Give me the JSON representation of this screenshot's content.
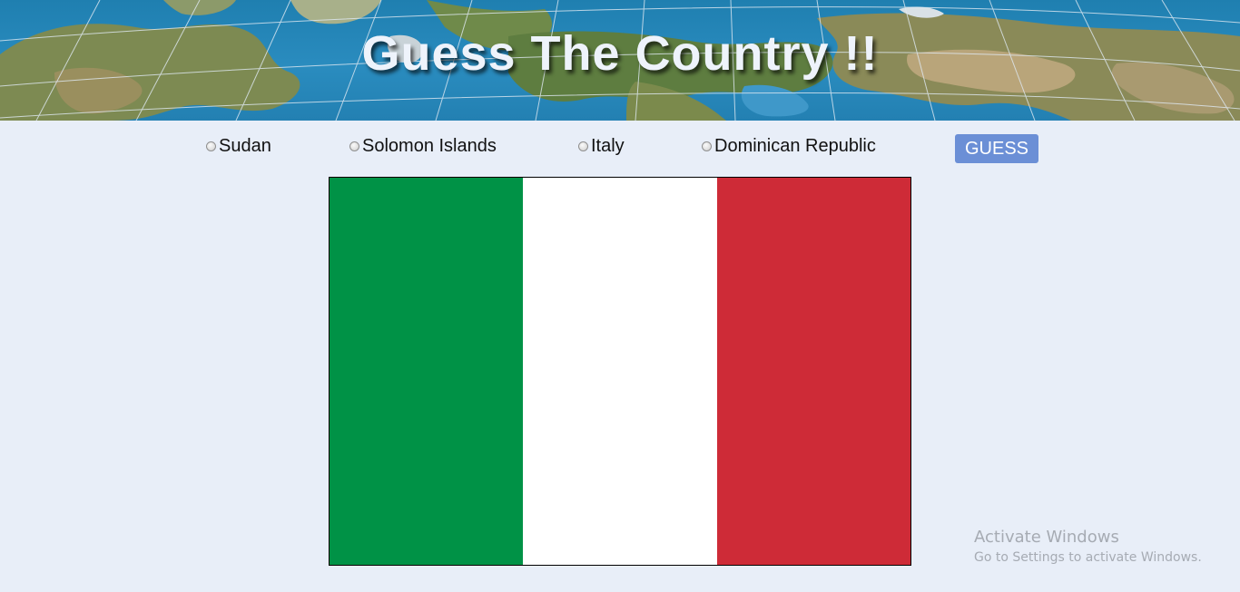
{
  "header": {
    "title": "Guess The Country !!"
  },
  "quiz": {
    "options": [
      {
        "label": "Sudan"
      },
      {
        "label": "Solomon Islands"
      },
      {
        "label": "Italy"
      },
      {
        "label": "Dominican Republic"
      }
    ],
    "guess_label": "GUESS"
  },
  "flag": {
    "country_colors": [
      "#009246",
      "#ffffff",
      "#ce2b37"
    ]
  },
  "watermark": {
    "title": "Activate Windows",
    "subtitle": "Go to Settings to activate Windows."
  },
  "colors": {
    "page_background": "#e8eef8",
    "guess_button": "#6b8fd6"
  }
}
